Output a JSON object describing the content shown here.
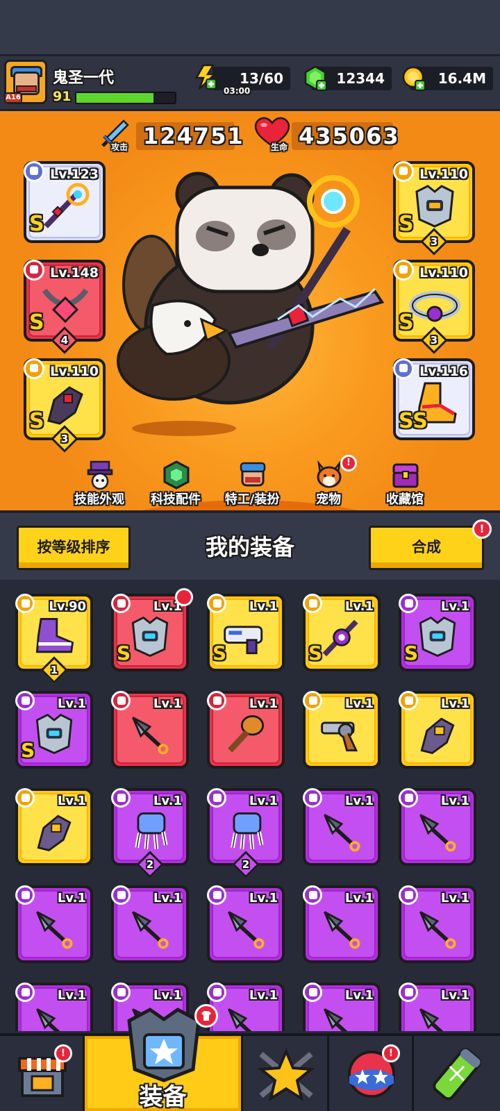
{
  "player": {
    "name": "鬼圣一代",
    "level": "91",
    "avatar_badge": "A16",
    "xp_progress": 0.78
  },
  "resources": {
    "energy": "13/60",
    "energy_timer": "03:00",
    "gems": "12344",
    "gold": "16.4M"
  },
  "stats": {
    "attack_value": "124751",
    "attack_label": "攻击",
    "hp_value": "435063",
    "hp_label": "生命"
  },
  "equipped": {
    "weapon": {
      "level": "Lv.123",
      "rarity": "S",
      "type_icon": "weapon-icon"
    },
    "necklace": {
      "level": "Lv.148",
      "rarity": "S",
      "count": "4",
      "type_icon": "necklace-icon"
    },
    "gloves": {
      "level": "Lv.110",
      "rarity": "S",
      "count": "3",
      "type_icon": "gloves-icon"
    },
    "armor": {
      "level": "Lv.110",
      "rarity": "S",
      "count": "3",
      "type_icon": "armor-icon"
    },
    "belt": {
      "level": "Lv.110",
      "rarity": "S",
      "count": "3",
      "type_icon": "belt-icon"
    },
    "boots": {
      "level": "Lv.116",
      "rarity": "SS",
      "type_icon": "boots-icon"
    }
  },
  "subnav": {
    "skill_skin": "技能外观",
    "tech_parts": "科技配件",
    "agent_outfit": "特工/装扮",
    "pet": "宠物",
    "collection": "收藏馆"
  },
  "equip_panel": {
    "title": "我的装备",
    "sort_button": "按等级排序",
    "merge_button": "合成",
    "notif": "!"
  },
  "inventory": [
    {
      "level": "Lv.90",
      "rarity": "",
      "count": "1",
      "color": "yellow",
      "type": "boots",
      "item": "sneaker"
    },
    {
      "level": "Lv.1",
      "rarity": "S",
      "count": "",
      "color": "red",
      "type": "armor",
      "item": "armor",
      "badge": "shirt"
    },
    {
      "level": "Lv.1",
      "rarity": "S",
      "count": "",
      "color": "yellow",
      "type": "weapon",
      "item": "gun"
    },
    {
      "level": "Lv.1",
      "rarity": "S",
      "count": "",
      "color": "yellow",
      "type": "weapon",
      "item": "staff"
    },
    {
      "level": "Lv.1",
      "rarity": "S",
      "count": "",
      "color": "purple",
      "type": "armor",
      "item": "armor"
    },
    {
      "level": "Lv.1",
      "rarity": "S",
      "count": "",
      "color": "purple",
      "type": "armor",
      "item": "armor"
    },
    {
      "level": "Lv.1",
      "rarity": "",
      "count": "",
      "color": "red",
      "type": "weapon",
      "item": "kunai"
    },
    {
      "level": "Lv.1",
      "rarity": "",
      "count": "",
      "color": "red",
      "type": "weapon",
      "item": "torch"
    },
    {
      "level": "Lv.1",
      "rarity": "",
      "count": "",
      "color": "yellow",
      "type": "weapon",
      "item": "revolver"
    },
    {
      "level": "Lv.1",
      "rarity": "",
      "count": "",
      "color": "yellow",
      "type": "gloves",
      "item": "gauntlet"
    },
    {
      "level": "Lv.1",
      "rarity": "",
      "count": "",
      "color": "yellow",
      "type": "gloves",
      "item": "gauntlet"
    },
    {
      "level": "Lv.1",
      "rarity": "",
      "count": "2",
      "color": "purple",
      "type": "gloves",
      "item": "claw"
    },
    {
      "level": "Lv.1",
      "rarity": "",
      "count": "2",
      "color": "purple",
      "type": "gloves",
      "item": "claw"
    },
    {
      "level": "Lv.1",
      "rarity": "",
      "count": "",
      "color": "purple",
      "type": "weapon",
      "item": "kunai"
    },
    {
      "level": "Lv.1",
      "rarity": "",
      "count": "",
      "color": "purple",
      "type": "weapon",
      "item": "kunai"
    },
    {
      "level": "Lv.1",
      "rarity": "",
      "count": "",
      "color": "purple",
      "type": "weapon",
      "item": "kunai"
    },
    {
      "level": "Lv.1",
      "rarity": "",
      "count": "",
      "color": "purple",
      "type": "weapon",
      "item": "kunai"
    },
    {
      "level": "Lv.1",
      "rarity": "",
      "count": "",
      "color": "purple",
      "type": "weapon",
      "item": "kunai"
    },
    {
      "level": "Lv.1",
      "rarity": "",
      "count": "",
      "color": "purple",
      "type": "weapon",
      "item": "kunai"
    },
    {
      "level": "Lv.1",
      "rarity": "",
      "count": "",
      "color": "purple",
      "type": "weapon",
      "item": "kunai"
    },
    {
      "level": "Lv.1",
      "rarity": "",
      "count": "",
      "color": "purple",
      "type": "weapon",
      "item": "kunai"
    },
    {
      "level": "Lv.1",
      "rarity": "",
      "count": "",
      "color": "purple",
      "type": "weapon",
      "item": "kunai"
    },
    {
      "level": "Lv.1",
      "rarity": "",
      "count": "",
      "color": "purple",
      "type": "weapon",
      "item": "kunai"
    },
    {
      "level": "Lv.1",
      "rarity": "",
      "count": "",
      "color": "purple",
      "type": "weapon",
      "item": "kunai"
    },
    {
      "level": "Lv.1",
      "rarity": "",
      "count": "",
      "color": "purple",
      "type": "weapon",
      "item": "kunai"
    }
  ],
  "bottom_nav": {
    "shop_icon": "shop-icon",
    "equip_label": "装备",
    "talent_icon": "talent-star-icon",
    "gacha_icon": "gacha-egg-icon",
    "evolution_icon": "dna-capsule-icon",
    "notif": "!"
  },
  "colors": {
    "yellow": "#ffca1a",
    "red": "#e8344a",
    "purple": "#b130de",
    "accent_orange": "#f38a16"
  }
}
